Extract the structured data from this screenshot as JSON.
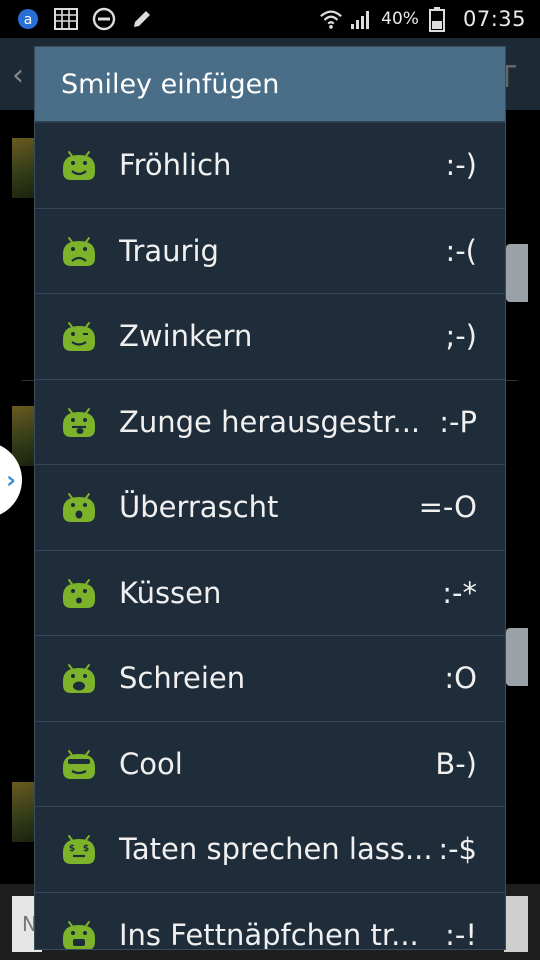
{
  "status_bar": {
    "icons_left": [
      "app-a-icon",
      "grid-icon",
      "do-not-disturb-icon",
      "pen-icon"
    ],
    "battery_percent": "40%",
    "time": "07:35",
    "icons_right": [
      "wifi-icon",
      "signal-icon",
      "battery-icon"
    ]
  },
  "dialog": {
    "title": "Smiley einfügen",
    "items": [
      {
        "label": "Fröhlich",
        "code": ":-)",
        "icon": "happy-android-icon"
      },
      {
        "label": "Traurig",
        "code": ":-(",
        "icon": "sad-android-icon"
      },
      {
        "label": "Zwinkern",
        "code": ";-)",
        "icon": "wink-android-icon"
      },
      {
        "label": "Zunge herausgestr...",
        "code": ":-P",
        "icon": "tongue-android-icon"
      },
      {
        "label": "Überrascht",
        "code": "=-O",
        "icon": "surprised-android-icon"
      },
      {
        "label": "Küssen",
        "code": ":-*",
        "icon": "kiss-android-icon"
      },
      {
        "label": "Schreien",
        "code": ":O",
        "icon": "yell-android-icon"
      },
      {
        "label": "Cool",
        "code": "B-)",
        "icon": "cool-android-icon"
      },
      {
        "label": "Taten sprechen lass...",
        "code": ":-$",
        "icon": "money-android-icon"
      },
      {
        "label": "Ins Fettnäpfchen tr...",
        "code": ":-!",
        "icon": "foot-in-mouth-android-icon"
      }
    ]
  },
  "colors": {
    "dialog_bg": "#1f2c39",
    "title_bg": "#4a6e88",
    "icon_green": "#7cb32a",
    "divider": "#34475a"
  }
}
